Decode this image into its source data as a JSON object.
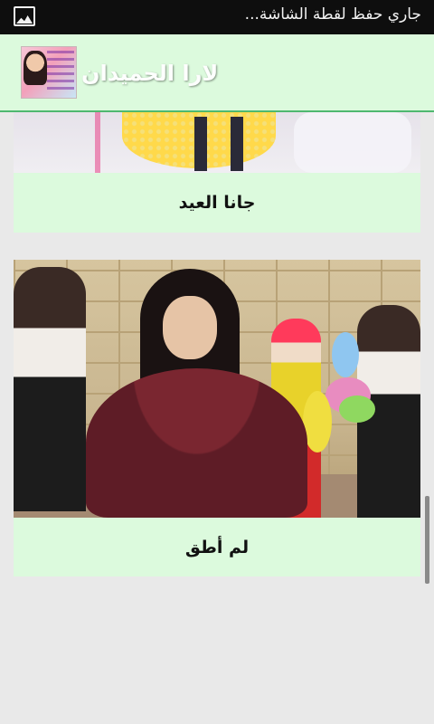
{
  "status_bar": {
    "notification_text": "جاري حفظ لقطة الشاشة...",
    "icon": "image-icon"
  },
  "header": {
    "title": "لارا الحميدان",
    "app_icon": "app-logo-icon"
  },
  "videos": [
    {
      "title": "جانا العيد"
    },
    {
      "title": "لم أطق"
    }
  ],
  "colors": {
    "card_background": "#dcfadd",
    "page_background": "#e9e9e9",
    "header_underline": "#4fb870",
    "status_bar": "#0e0e0e"
  }
}
